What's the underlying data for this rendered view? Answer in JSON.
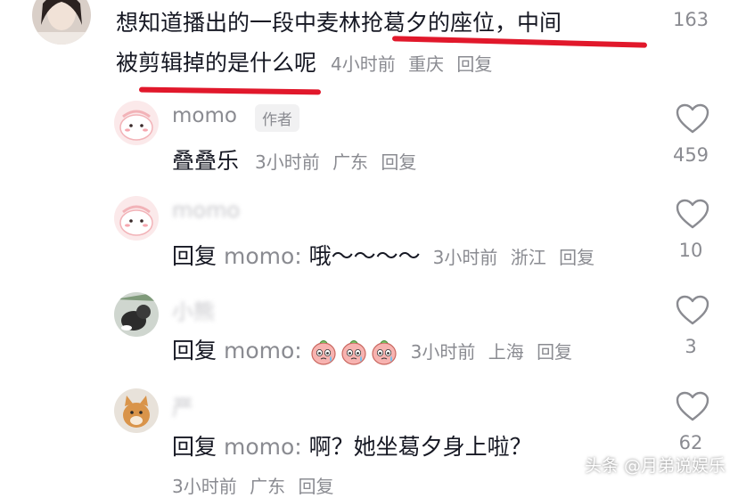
{
  "top_comment": {
    "line1": "想知道播出的一段中麦林抢葛夕的座位，中间",
    "line2": "被剪辑掉的是什么呢",
    "time": "4小时前",
    "location": "重庆",
    "reply": "回复",
    "count": "163"
  },
  "replies": [
    {
      "username": "momo",
      "badge": "作者",
      "text": "叠叠乐",
      "time": "3小时前",
      "location": "广东",
      "reply": "回复",
      "likes": "459"
    },
    {
      "username": "momo",
      "reply_prefix": "回复",
      "reply_target": "momo:",
      "text": "哦～～～～",
      "time": "3小时前",
      "location": "浙江",
      "reply": "回复",
      "likes": "10"
    },
    {
      "username": "小熊",
      "reply_prefix": "回复",
      "reply_target": "momo:",
      "emoji_count": 3,
      "time": "3小时前",
      "location": "上海",
      "reply": "回复",
      "likes": "3"
    },
    {
      "username": "严",
      "reply_prefix": "回复",
      "reply_target": "momo:",
      "text": "啊？她坐葛夕身上啦？",
      "likes": "62",
      "time": "3小时前",
      "location": "广东",
      "reply": "回复"
    }
  ],
  "watermark": "头条 @月弟说娱乐",
  "colors": {
    "primary_text": "#161823",
    "secondary_text": "#8a8b91",
    "highlight": "#e1182b"
  }
}
